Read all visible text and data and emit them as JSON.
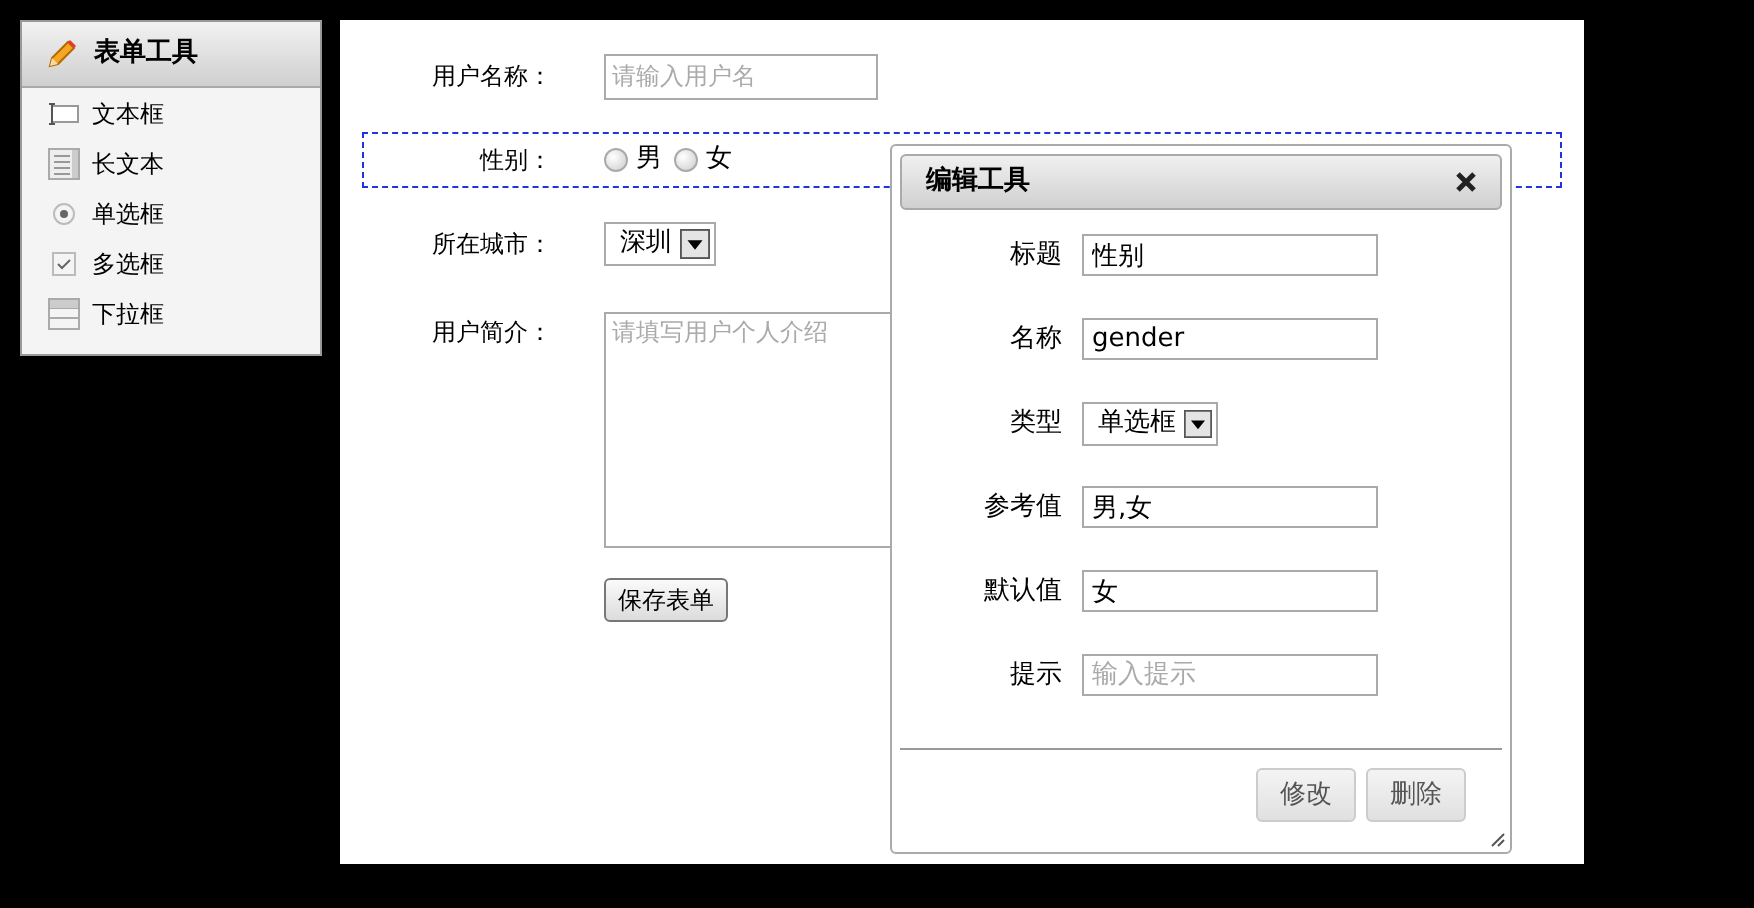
{
  "toolbox": {
    "title": "表单工具",
    "items": [
      {
        "kind": "text",
        "label": "文本框"
      },
      {
        "kind": "textarea",
        "label": "长文本"
      },
      {
        "kind": "radio",
        "label": "单选框"
      },
      {
        "kind": "checkbox",
        "label": "多选框"
      },
      {
        "kind": "select",
        "label": "下拉框"
      }
    ]
  },
  "form": {
    "fields": [
      {
        "kind": "text",
        "label": "用户名称：",
        "placeholder": "请输入用户名",
        "highlighted": false
      },
      {
        "kind": "radio",
        "label": "性别：",
        "options": [
          {
            "label": "男",
            "selected": false
          },
          {
            "label": "女",
            "selected": false
          }
        ],
        "highlighted": true
      },
      {
        "kind": "select",
        "label": "所在城市：",
        "value": "深圳",
        "highlighted": false
      },
      {
        "kind": "textarea",
        "label": "用户简介：",
        "placeholder": "请填写用户个人介绍",
        "highlighted": false
      }
    ],
    "submit": "保存表单"
  },
  "dialog": {
    "title": "编辑工具",
    "fields": [
      {
        "kind": "text",
        "label": "标题",
        "value": "性别"
      },
      {
        "kind": "text",
        "label": "名称",
        "value": "gender"
      },
      {
        "kind": "select",
        "label": "类型",
        "value": "单选框"
      },
      {
        "kind": "text",
        "label": "参考值",
        "value": "男,女"
      },
      {
        "kind": "text",
        "label": "默认值",
        "value": "女"
      },
      {
        "kind": "text",
        "label": "提示",
        "placeholder": "输入提示"
      }
    ],
    "buttons": [
      "修改",
      "删除"
    ]
  }
}
